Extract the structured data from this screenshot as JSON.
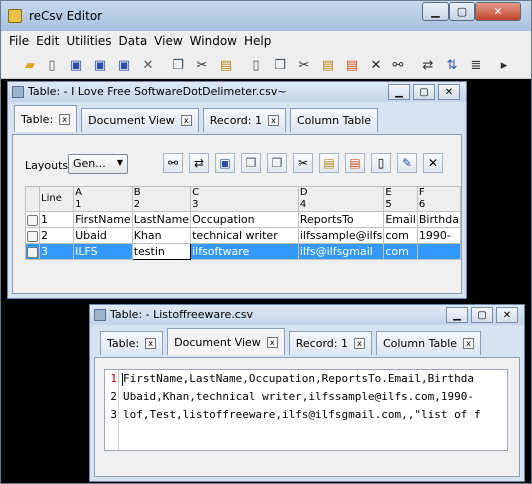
{
  "window": {
    "title": "reCsv Editor"
  },
  "menu": [
    "File",
    "Edit",
    "Utilities",
    "Data",
    "View",
    "Window",
    "Help"
  ],
  "toolbar_icons": [
    "open-folder-icon",
    "new-file-icon",
    "save-icon",
    "save-all-icon",
    "save-as-icon",
    "delete-icon",
    "copy-icon",
    "cut-icon",
    "paste-icon",
    "new-doc-icon",
    "copy2-icon",
    "cut2-icon",
    "paste2-icon",
    "paste-special-icon",
    "delete-x-icon",
    "find-icon",
    "transpose-icon",
    "sort-icon",
    "list-icon",
    "more-icon"
  ],
  "frame1": {
    "title": "Table: - I Love Free SoftwareDotDelimeter.csv~",
    "tabs": [
      {
        "label": "Table:",
        "active": true
      },
      {
        "label": "Document View",
        "active": false
      },
      {
        "label": "Record: 1",
        "active": false
      },
      {
        "label": "Column Table",
        "active": false
      }
    ],
    "layouts_label": "Layouts",
    "layouts_value": "Gen...",
    "columns": [
      {
        "letter": "Line",
        "num": ""
      },
      {
        "letter": "A",
        "num": "1"
      },
      {
        "letter": "B",
        "num": "2"
      },
      {
        "letter": "C",
        "num": "3"
      },
      {
        "letter": "D",
        "num": "4"
      },
      {
        "letter": "E",
        "num": "5"
      },
      {
        "letter": "F",
        "num": "6"
      }
    ],
    "rows": [
      [
        "1",
        "FirstName",
        "LastName",
        "Occupation",
        "ReportsTo",
        "Email",
        "Birthda"
      ],
      [
        "2",
        "Ubaid",
        "Khan",
        "technical writer",
        "ilfssample@ilfs",
        "com",
        "1990-"
      ],
      [
        "3",
        "ILFS",
        "testin",
        "ilfsoftware",
        "ilfs@ilfsgmail",
        "com",
        ""
      ]
    ]
  },
  "frame2": {
    "title": "Table: - Listoffreeware.csv",
    "tabs": [
      {
        "label": "Table:",
        "active": false
      },
      {
        "label": "Document View",
        "active": true
      },
      {
        "label": "Record: 1",
        "active": false
      },
      {
        "label": "Column Table",
        "active": false
      }
    ],
    "lines": [
      {
        "num": "1",
        "text": "FirstName,LastName,Occupation,ReportsTo.Email,Birthda"
      },
      {
        "num": "2",
        "text": "Ubaid,Khan,technical writer,ilfssample@ilfs.com,1990-"
      },
      {
        "num": "3",
        "text": "lof,Test,listoffreeware,ilfs@ilfsgmail.com,,\"list of f"
      }
    ]
  }
}
